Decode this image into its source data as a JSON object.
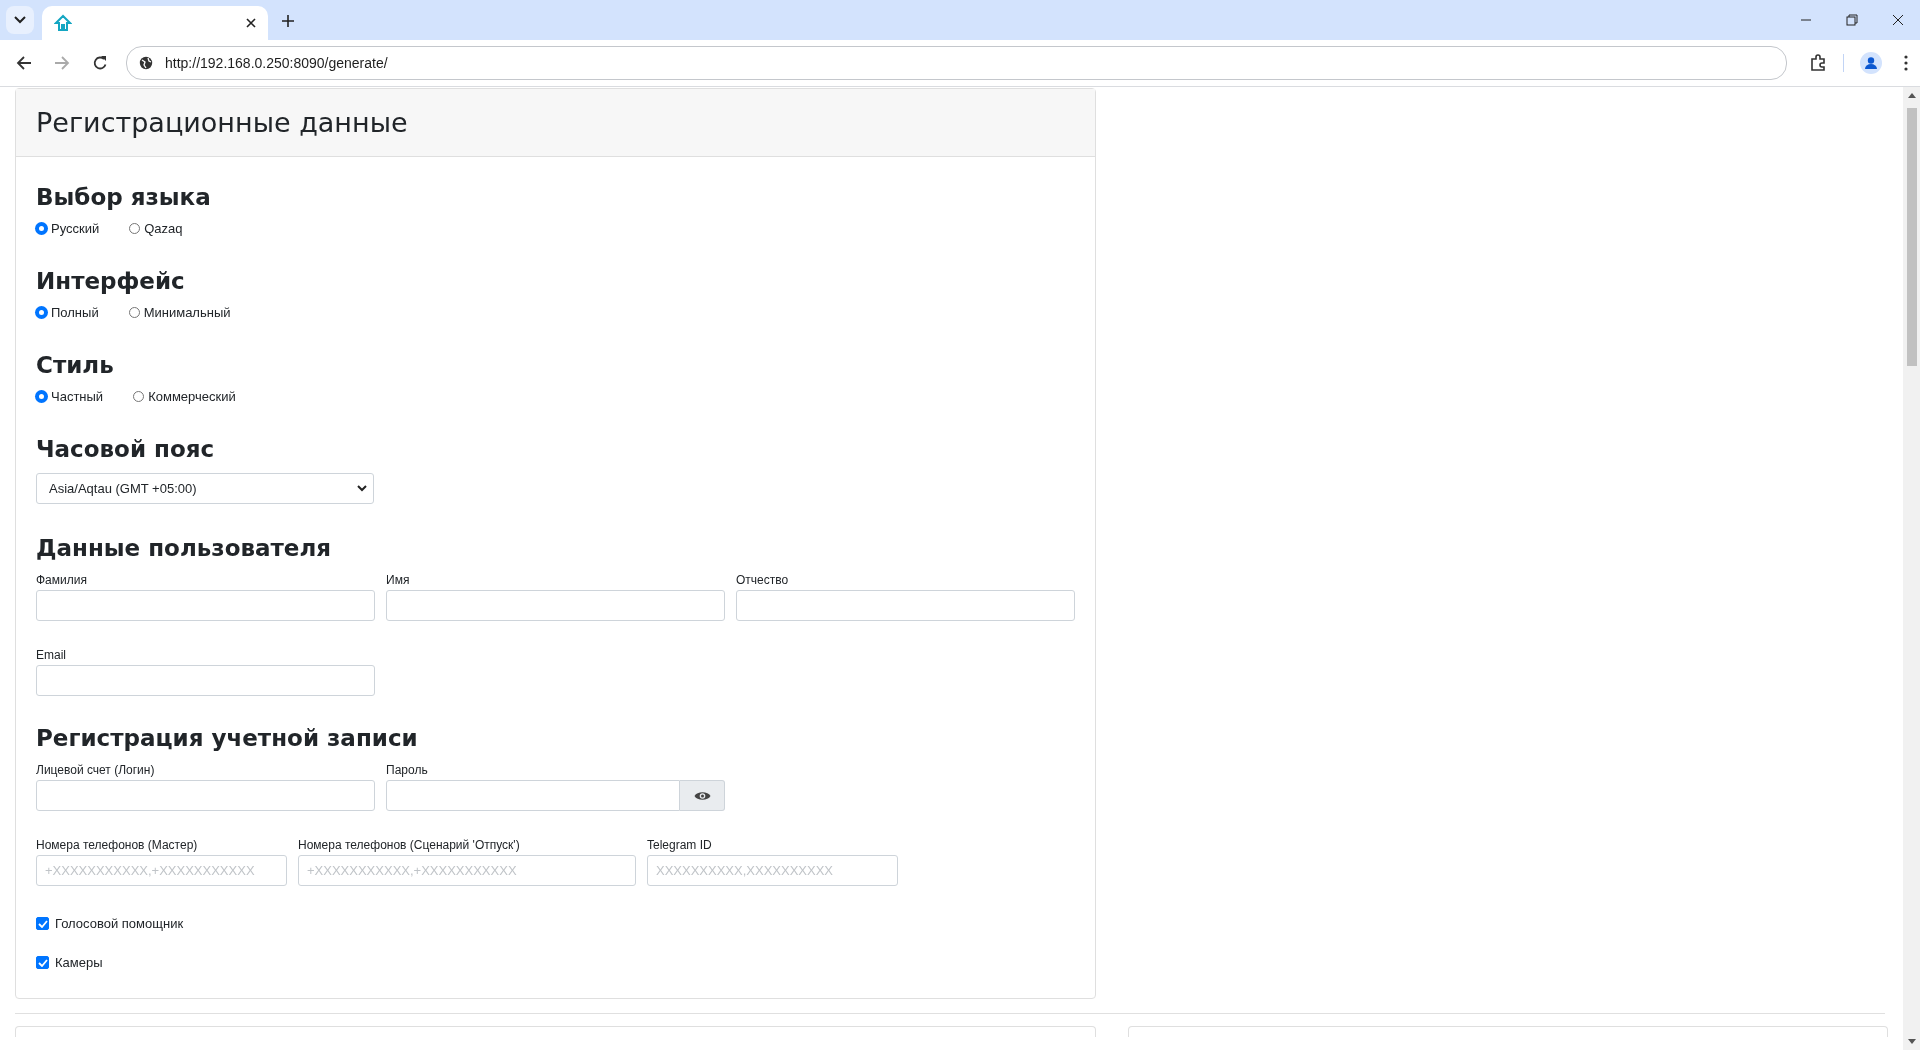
{
  "browser": {
    "url": "http://192.168.0.250:8090/generate/"
  },
  "card_title": "Регистрационные данные",
  "radio_groups": [
    {
      "title": "Выбор языка",
      "options": [
        {
          "label": "Русский",
          "selected": true
        },
        {
          "label": "Qazaq",
          "selected": false
        }
      ]
    },
    {
      "title": "Интерфейс",
      "options": [
        {
          "label": "Полный",
          "selected": true
        },
        {
          "label": "Минимальный",
          "selected": false
        }
      ]
    },
    {
      "title": "Стиль",
      "options": [
        {
          "label": "Частный",
          "selected": true
        },
        {
          "label": "Коммерческий",
          "selected": false
        }
      ]
    }
  ],
  "timezone": {
    "title": "Часовой пояс",
    "value": "Asia/Aqtau (GMT +05:00)"
  },
  "user_data": {
    "title": "Данные пользователя",
    "fields": [
      {
        "label": "Фамилия"
      },
      {
        "label": "Имя"
      },
      {
        "label": "Отчество"
      }
    ],
    "email_label": "Email"
  },
  "account": {
    "title": "Регистрация учетной записи",
    "login_label": "Лицевой счет (Логин)",
    "password_label": "Пароль",
    "phone_fields": [
      {
        "label": "Номера телефонов (Мастер)",
        "placeholder": "+XXXXXXXXXXX,+XXXXXXXXXXX"
      },
      {
        "label": "Номера телефонов (Сценарий 'Отпуск')",
        "placeholder": "+XXXXXXXXXXX,+XXXXXXXXXXX"
      },
      {
        "label": "Telegram ID",
        "placeholder": "XXXXXXXXXX,XXXXXXXXXX"
      }
    ],
    "checkboxes": [
      {
        "label": "Голосовой помощник",
        "checked": true
      },
      {
        "label": "Камеры",
        "checked": true
      }
    ]
  }
}
